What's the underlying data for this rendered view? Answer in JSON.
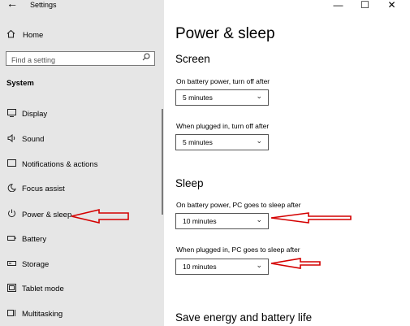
{
  "window": {
    "app_title": "Settings",
    "back_glyph": "←",
    "minimize_glyph": "—",
    "maximize_glyph": "☐",
    "close_glyph": "✕"
  },
  "sidebar": {
    "home": {
      "label": "Home",
      "icon": "home-icon"
    },
    "search": {
      "placeholder": "Find a setting",
      "icon": "search-icon"
    },
    "section": "System",
    "items": [
      {
        "label": "Display",
        "icon": "display-icon",
        "glyph": "▭"
      },
      {
        "label": "Sound",
        "icon": "speaker-icon",
        "glyph": "🔊"
      },
      {
        "label": "Notifications & actions",
        "icon": "notifications-icon",
        "glyph": "▢"
      },
      {
        "label": "Focus assist",
        "icon": "moon-icon",
        "glyph": "☾"
      },
      {
        "label": "Power & sleep",
        "icon": "power-icon",
        "glyph": "⏻"
      },
      {
        "label": "Battery",
        "icon": "battery-icon",
        "glyph": "▭"
      },
      {
        "label": "Storage",
        "icon": "storage-icon",
        "glyph": "▭"
      },
      {
        "label": "Tablet mode",
        "icon": "tablet-icon",
        "glyph": "▣"
      },
      {
        "label": "Multitasking",
        "icon": "multitasking-icon",
        "glyph": "▤"
      }
    ]
  },
  "main": {
    "title": "Power & sleep",
    "screen": {
      "heading": "Screen",
      "battery_label": "On battery power, turn off after",
      "battery_value": "5 minutes",
      "plugged_label": "When plugged in, turn off after",
      "plugged_value": "5 minutes"
    },
    "sleep": {
      "heading": "Sleep",
      "battery_label": "On battery power, PC goes to sleep after",
      "battery_value": "10 minutes",
      "plugged_label": "When plugged in, PC goes to sleep after",
      "plugged_value": "10 minutes"
    },
    "energy_heading": "Save energy and battery life",
    "chevron_glyph": "⌄",
    "annotation_color": "#d40000"
  }
}
